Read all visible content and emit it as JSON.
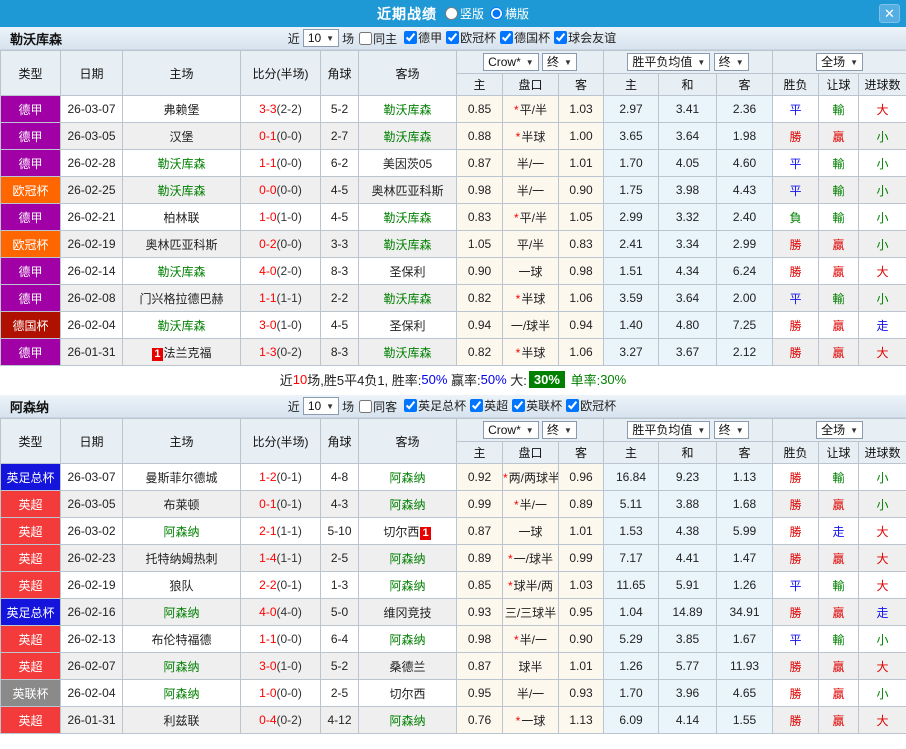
{
  "titlebar": {
    "title": "近期战绩",
    "vertical_label": "竖版",
    "horizontal_label": "横版",
    "close_glyph": "✕"
  },
  "table_header": {
    "col_type": "类型",
    "col_date": "日期",
    "col_home": "主场",
    "col_score": "比分(半场)",
    "col_corner": "角球",
    "col_away": "客场",
    "odds_company": "Crow*",
    "final_label": "终",
    "wdl_label": "胜平负均值",
    "full_label": "全场",
    "sub_home": "主",
    "sub_handicap": "盘口",
    "sub_away": "客",
    "sub_home2": "主",
    "sub_draw": "和",
    "sub_away2": "客",
    "sub_result": "胜负",
    "sub_handicap_result": "让球",
    "sub_goals": "进球数"
  },
  "colors": {
    "type": {
      "德甲": "#A000A6",
      "欧冠杯": "#FF6600",
      "德国杯": "#AF1000",
      "英足总杯": "#1414DC",
      "英超": "#F43B3B",
      "英联杯": "#8A8A8A"
    },
    "mark": {
      "勝": "#E00000",
      "平": "#1010EE",
      "負": "#008000",
      "贏": "#E00000",
      "輸": "#008000",
      "走": "#1010EE",
      "大": "#E00000",
      "小": "#008000"
    }
  },
  "sections": [
    {
      "team": "勒沃库森",
      "near_label": "近",
      "games_value": "10",
      "games_label": "场",
      "same_label": "同主",
      "leagues": [
        "德甲",
        "欧冠杯",
        "德国杯",
        "球会友谊"
      ],
      "rows": [
        {
          "type": "德甲",
          "date": "26-03-07",
          "home": "弗赖堡",
          "home_self": false,
          "score": "3-3",
          "half": "(2-2)",
          "corner": "5-2",
          "away": "勒沃库森",
          "away_self": true,
          "o1": "0.85",
          "star": true,
          "hcap": "平/半",
          "o2": "1.03",
          "w": "2.97",
          "d": "3.41",
          "l": "2.36",
          "res": "平",
          "hres": "輸",
          "goal": "大"
        },
        {
          "type": "德甲",
          "date": "26-03-05",
          "home": "汉堡",
          "home_self": false,
          "score": "0-1",
          "half": "(0-0)",
          "corner": "2-7",
          "away": "勒沃库森",
          "away_self": true,
          "o1": "0.88",
          "star": true,
          "hcap": "半球",
          "o2": "1.00",
          "w": "3.65",
          "d": "3.64",
          "l": "1.98",
          "res": "勝",
          "hres": "贏",
          "goal": "小"
        },
        {
          "type": "德甲",
          "date": "26-02-28",
          "home": "勒沃库森",
          "home_self": true,
          "score": "1-1",
          "half": "(0-0)",
          "corner": "6-2",
          "away": "美因茨05",
          "away_self": false,
          "o1": "0.87",
          "star": false,
          "hcap": "半/一",
          "o2": "1.01",
          "w": "1.70",
          "d": "4.05",
          "l": "4.60",
          "res": "平",
          "hres": "輸",
          "goal": "小"
        },
        {
          "type": "欧冠杯",
          "date": "26-02-25",
          "home": "勒沃库森",
          "home_self": true,
          "score": "0-0",
          "half": "(0-0)",
          "corner": "4-5",
          "away": "奥林匹亚科斯",
          "away_self": false,
          "o1": "0.98",
          "star": false,
          "hcap": "半/一",
          "o2": "0.90",
          "w": "1.75",
          "d": "3.98",
          "l": "4.43",
          "res": "平",
          "hres": "輸",
          "goal": "小"
        },
        {
          "type": "德甲",
          "date": "26-02-21",
          "home": "柏林联",
          "home_self": false,
          "score": "1-0",
          "half": "(1-0)",
          "corner": "4-5",
          "away": "勒沃库森",
          "away_self": true,
          "o1": "0.83",
          "star": true,
          "hcap": "平/半",
          "o2": "1.05",
          "w": "2.99",
          "d": "3.32",
          "l": "2.40",
          "res": "負",
          "hres": "輸",
          "goal": "小"
        },
        {
          "type": "欧冠杯",
          "date": "26-02-19",
          "home": "奥林匹亚科斯",
          "home_self": false,
          "score": "0-2",
          "half": "(0-0)",
          "corner": "3-3",
          "away": "勒沃库森",
          "away_self": true,
          "o1": "1.05",
          "star": false,
          "hcap": "平/半",
          "o2": "0.83",
          "w": "2.41",
          "d": "3.34",
          "l": "2.99",
          "res": "勝",
          "hres": "贏",
          "goal": "小"
        },
        {
          "type": "德甲",
          "date": "26-02-14",
          "home": "勒沃库森",
          "home_self": true,
          "score": "4-0",
          "half": "(2-0)",
          "corner": "8-3",
          "away": "圣保利",
          "away_self": false,
          "o1": "0.90",
          "star": false,
          "hcap": "一球",
          "o2": "0.98",
          "w": "1.51",
          "d": "4.34",
          "l": "6.24",
          "res": "勝",
          "hres": "贏",
          "goal": "大"
        },
        {
          "type": "德甲",
          "date": "26-02-08",
          "home": "门兴格拉德巴赫",
          "home_self": false,
          "score": "1-1",
          "half": "(1-1)",
          "corner": "2-2",
          "away": "勒沃库森",
          "away_self": true,
          "o1": "0.82",
          "star": true,
          "hcap": "半球",
          "o2": "1.06",
          "w": "3.59",
          "d": "3.64",
          "l": "2.00",
          "res": "平",
          "hres": "輸",
          "goal": "小"
        },
        {
          "type": "德国杯",
          "date": "26-02-04",
          "home": "勒沃库森",
          "home_self": true,
          "score": "3-0",
          "half": "(1-0)",
          "corner": "4-5",
          "away": "圣保利",
          "away_self": false,
          "o1": "0.94",
          "star": false,
          "hcap": "一/球半",
          "o2": "0.94",
          "w": "1.40",
          "d": "4.80",
          "l": "7.25",
          "res": "勝",
          "hres": "贏",
          "goal": "走"
        },
        {
          "type": "德甲",
          "date": "26-01-31",
          "home": "法兰克福",
          "home_self": false,
          "home_badge": {
            "text": "1",
            "side": "left"
          },
          "score": "1-3",
          "half": "(0-2)",
          "corner": "8-3",
          "away": "勒沃库森",
          "away_self": true,
          "o1": "0.82",
          "star": true,
          "hcap": "半球",
          "o2": "1.06",
          "w": "3.27",
          "d": "3.67",
          "l": "2.12",
          "res": "勝",
          "hres": "贏",
          "goal": "大"
        }
      ],
      "summary_segments": [
        {
          "text": "近",
          "color": "#222222"
        },
        {
          "text": "10",
          "color": "#FF0000"
        },
        {
          "text": "场,胜5平4负1, 胜率:",
          "color": "#222222"
        },
        {
          "text": "50%",
          "color": "#0000EE"
        },
        {
          "text": " 赢率:",
          "color": "#222222"
        },
        {
          "text": "50%",
          "color": "#0000EE"
        },
        {
          "text": " 大:",
          "color": "#222222"
        },
        {
          "text": "30%",
          "color": "#FFFFFF",
          "bg": "#008000"
        },
        {
          "text": " 单率:",
          "color": "#008000"
        },
        {
          "text": "30%",
          "color": "#008000"
        }
      ]
    },
    {
      "team": "阿森纳",
      "near_label": "近",
      "games_value": "10",
      "games_label": "场",
      "same_label": "同客",
      "leagues": [
        "英足总杯",
        "英超",
        "英联杯",
        "欧冠杯"
      ],
      "rows": [
        {
          "type": "英足总杯",
          "date": "26-03-07",
          "home": "曼斯菲尔德城",
          "home_self": false,
          "score": "1-2",
          "half": "(0-1)",
          "corner": "4-8",
          "away": "阿森纳",
          "away_self": true,
          "o1": "0.92",
          "star": true,
          "hcap": "两/两球半",
          "o2": "0.96",
          "w": "16.84",
          "d": "9.23",
          "l": "1.13",
          "res": "勝",
          "hres": "輸",
          "goal": "小"
        },
        {
          "type": "英超",
          "date": "26-03-05",
          "home": "布莱顿",
          "home_self": false,
          "score": "0-1",
          "half": "(0-1)",
          "corner": "4-3",
          "away": "阿森纳",
          "away_self": true,
          "o1": "0.99",
          "star": true,
          "hcap": "半/一",
          "o2": "0.89",
          "w": "5.11",
          "d": "3.88",
          "l": "1.68",
          "res": "勝",
          "hres": "贏",
          "goal": "小"
        },
        {
          "type": "英超",
          "date": "26-03-02",
          "home": "阿森纳",
          "home_self": true,
          "score": "2-1",
          "half": "(1-1)",
          "corner": "5-10",
          "away": "切尔西",
          "away_self": false,
          "away_badge": {
            "text": "1",
            "side": "right"
          },
          "o1": "0.87",
          "star": false,
          "hcap": "一球",
          "o2": "1.01",
          "w": "1.53",
          "d": "4.38",
          "l": "5.99",
          "res": "勝",
          "hres": "走",
          "goal": "大"
        },
        {
          "type": "英超",
          "date": "26-02-23",
          "home": "托特纳姆热刺",
          "home_self": false,
          "score": "1-4",
          "half": "(1-1)",
          "corner": "2-5",
          "away": "阿森纳",
          "away_self": true,
          "o1": "0.89",
          "star": true,
          "hcap": "一/球半",
          "o2": "0.99",
          "w": "7.17",
          "d": "4.41",
          "l": "1.47",
          "res": "勝",
          "hres": "贏",
          "goal": "大"
        },
        {
          "type": "英超",
          "date": "26-02-19",
          "home": "狼队",
          "home_self": false,
          "score": "2-2",
          "half": "(0-1)",
          "corner": "1-3",
          "away": "阿森纳",
          "away_self": true,
          "o1": "0.85",
          "star": true,
          "hcap": "球半/两",
          "o2": "1.03",
          "w": "11.65",
          "d": "5.91",
          "l": "1.26",
          "res": "平",
          "hres": "輸",
          "goal": "大"
        },
        {
          "type": "英足总杯",
          "date": "26-02-16",
          "home": "阿森纳",
          "home_self": true,
          "score": "4-0",
          "half": "(4-0)",
          "corner": "5-0",
          "away": "维冈竞技",
          "away_self": false,
          "o1": "0.93",
          "star": false,
          "hcap": "三/三球半",
          "o2": "0.95",
          "w": "1.04",
          "d": "14.89",
          "l": "34.91",
          "res": "勝",
          "hres": "贏",
          "goal": "走"
        },
        {
          "type": "英超",
          "date": "26-02-13",
          "home": "布伦特福德",
          "home_self": false,
          "score": "1-1",
          "half": "(0-0)",
          "corner": "6-4",
          "away": "阿森纳",
          "away_self": true,
          "o1": "0.98",
          "star": true,
          "hcap": "半/一",
          "o2": "0.90",
          "w": "5.29",
          "d": "3.85",
          "l": "1.67",
          "res": "平",
          "hres": "輸",
          "goal": "小"
        },
        {
          "type": "英超",
          "date": "26-02-07",
          "home": "阿森纳",
          "home_self": true,
          "score": "3-0",
          "half": "(1-0)",
          "corner": "5-2",
          "away": "桑德兰",
          "away_self": false,
          "o1": "0.87",
          "star": false,
          "hcap": "球半",
          "o2": "1.01",
          "w": "1.26",
          "d": "5.77",
          "l": "11.93",
          "res": "勝",
          "hres": "贏",
          "goal": "大"
        },
        {
          "type": "英联杯",
          "date": "26-02-04",
          "home": "阿森纳",
          "home_self": true,
          "score": "1-0",
          "half": "(0-0)",
          "corner": "2-5",
          "away": "切尔西",
          "away_self": false,
          "o1": "0.95",
          "star": false,
          "hcap": "半/一",
          "o2": "0.93",
          "w": "1.70",
          "d": "3.96",
          "l": "4.65",
          "res": "勝",
          "hres": "贏",
          "goal": "小"
        },
        {
          "type": "英超",
          "date": "26-01-31",
          "home": "利兹联",
          "home_self": false,
          "score": "0-4",
          "half": "(0-2)",
          "corner": "4-12",
          "away": "阿森纳",
          "away_self": true,
          "o1": "0.76",
          "star": true,
          "hcap": "一球",
          "o2": "1.13",
          "w": "6.09",
          "d": "4.14",
          "l": "1.55",
          "res": "勝",
          "hres": "贏",
          "goal": "大"
        }
      ]
    }
  ]
}
